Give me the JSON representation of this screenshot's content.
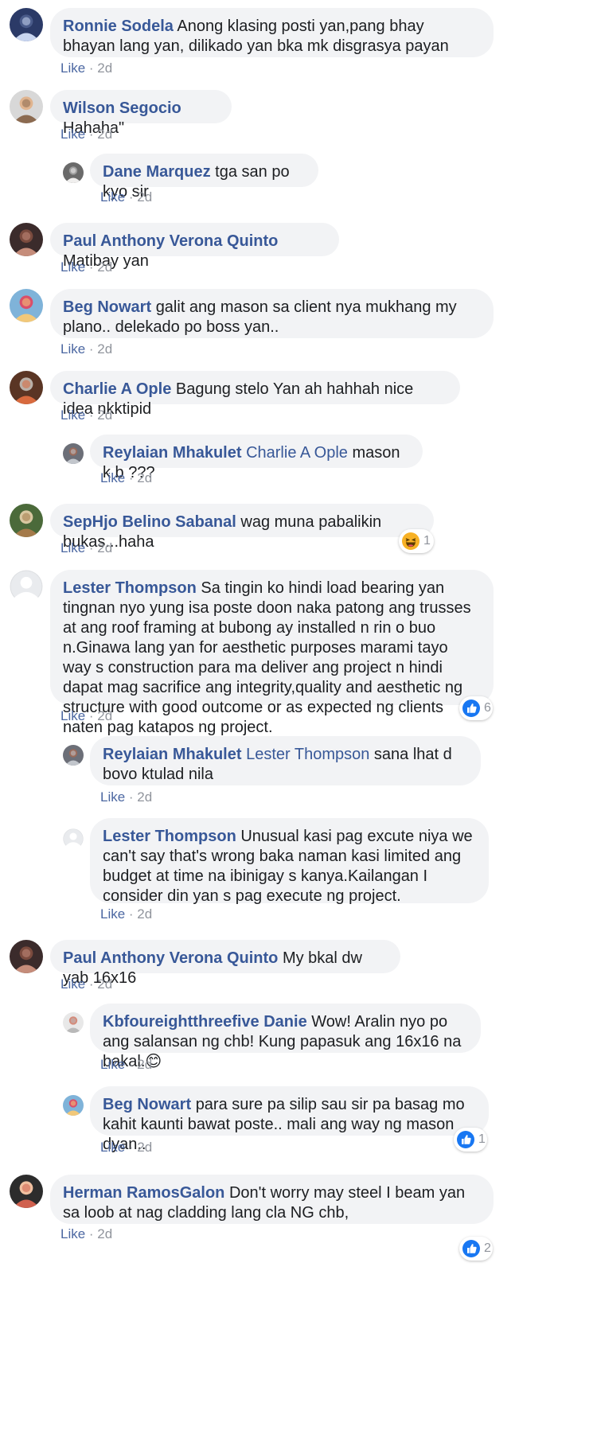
{
  "colors": {
    "bubble": "#f2f3f5",
    "author": "#385898",
    "meta": "#90949c",
    "like_blue": "#1877f2",
    "haha_yellow": "#f7b125"
  },
  "comments": [
    {
      "author": "Ronnie Sodela",
      "mention": "",
      "text": "Anong klasing posti yan,pang bhay bhayan lang yan, dilikado yan bka mk disgrasya payan",
      "like": "Like",
      "time": "2d",
      "avatar_icon": "avatar-photo-icon",
      "reaction": null
    },
    {
      "author": "Wilson Segocio",
      "mention": "",
      "text": "Hahaha\"",
      "like": "Like",
      "time": "2d",
      "avatar_icon": "avatar-photo-icon",
      "reaction": null
    },
    {
      "author": "Dane Marquez",
      "mention": "",
      "text": "tga san po kyo sir",
      "like": "Like",
      "time": "2d",
      "avatar_icon": "avatar-photo-icon",
      "reaction": null
    },
    {
      "author": "Paul Anthony Verona Quinto",
      "mention": "",
      "text": "Matibay yan",
      "like": "Like",
      "time": "2d",
      "avatar_icon": "avatar-photo-icon",
      "reaction": null
    },
    {
      "author": "Beg Nowart",
      "mention": "",
      "text": "galit ang mason sa client nya mukhang my plano.. delekado po boss yan..",
      "like": "Like",
      "time": "2d",
      "avatar_icon": "avatar-photo-icon",
      "reaction": null
    },
    {
      "author": "Charlie A Ople",
      "mention": "",
      "text": "Bagung stelo Yan ah hahhah nice idea nkktipid",
      "like": "Like",
      "time": "2d",
      "avatar_icon": "avatar-photo-icon",
      "reaction": null
    },
    {
      "author": "Reylaian Mhakulet",
      "mention": "Charlie A Ople",
      "text": "mason k b ???",
      "like": "Like",
      "time": "2d",
      "avatar_icon": "avatar-photo-icon",
      "reaction": null
    },
    {
      "author": "SepHjo Belino Sabanal",
      "mention": "",
      "text": "wag muna pabalikin bukas...haha",
      "like": "Like",
      "time": "2d",
      "avatar_icon": "avatar-photo-icon",
      "reaction": {
        "type": "haha",
        "icon": "haha-reaction-icon",
        "count": "1"
      }
    },
    {
      "author": "Lester Thompson",
      "mention": "",
      "text": "Sa tingin ko hindi load bearing yan tingnan nyo yung isa poste doon naka patong ang trusses at ang roof framing at bubong ay installed n rin o buo n.Ginawa lang yan for aesthetic purposes marami tayo way s construction para ma deliver ang project n hindi dapat mag sacrifice ang integrity,quality and aesthetic ng structure with good outcome or as expected ng clients naten pag katapos ng project.",
      "like": "Like",
      "time": "2d",
      "avatar_icon": "default-avatar-icon",
      "reaction": {
        "type": "like",
        "icon": "thumbs-up-reaction-icon",
        "count": "6"
      }
    },
    {
      "author": "Reylaian Mhakulet",
      "mention": "Lester Thompson",
      "text": "sana lhat d bovo ktulad nila",
      "like": "Like",
      "time": "2d",
      "avatar_icon": "avatar-photo-icon",
      "reaction": null
    },
    {
      "author": "Lester Thompson",
      "mention": "",
      "text": "Unusual kasi pag excute niya we can't say that's wrong baka naman kasi limited ang budget at time na ibinigay s kanya.Kailangan I consider din yan s pag execute ng project.",
      "like": "Like",
      "time": "2d",
      "avatar_icon": "default-avatar-icon",
      "reaction": null
    },
    {
      "author": "Paul Anthony Verona Quinto",
      "mention": "",
      "text": "My bkal dw yab 16x16",
      "like": "Like",
      "time": "2d",
      "avatar_icon": "avatar-photo-icon",
      "reaction": null
    },
    {
      "author": "Kbfoureightthreefive Danie",
      "mention": "",
      "text": "Wow! Aralin nyo po ang salansan ng chb! Kung papasuk ang 16x16 na bakal.😊",
      "like": "Like",
      "time": "2d",
      "avatar_icon": "avatar-photo-icon",
      "reaction": null
    },
    {
      "author": "Beg Nowart",
      "mention": "",
      "text": "para sure pa silip sau sir pa basag mo kahit kaunti bawat poste.. mali ang way ng mason dyan..",
      "like": "Like",
      "time": "2d",
      "avatar_icon": "avatar-photo-icon",
      "reaction": {
        "type": "like",
        "icon": "thumbs-up-reaction-icon",
        "count": "1"
      }
    },
    {
      "author": "Herman RamosGalon",
      "mention": "",
      "text": "Don't worry may steel I beam yan sa loob at nag cladding lang cla NG chb,",
      "like": "Like",
      "time": "2d",
      "avatar_icon": "avatar-photo-icon",
      "reaction": {
        "type": "like",
        "icon": "thumbs-up-reaction-icon",
        "count": "2"
      }
    }
  ]
}
